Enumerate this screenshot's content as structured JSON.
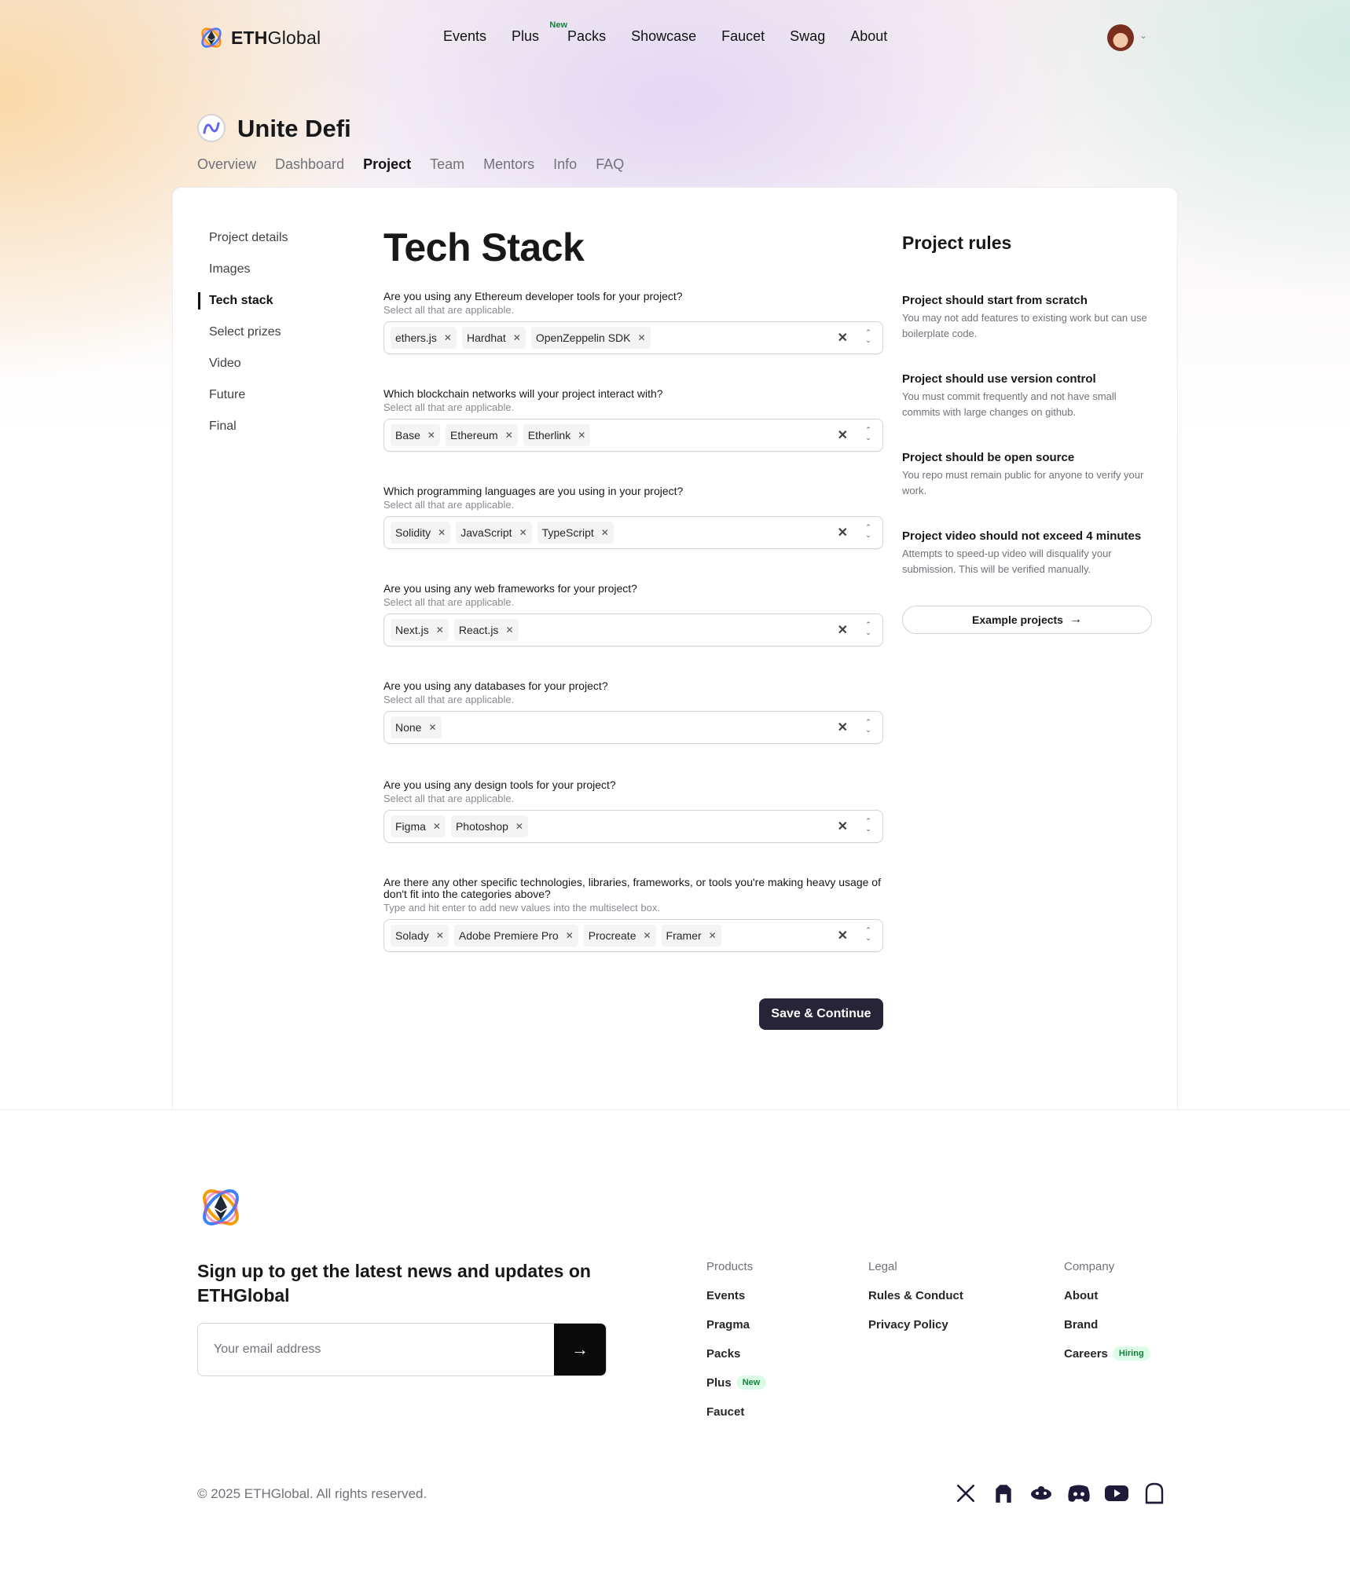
{
  "brand": {
    "name_bold": "ETH",
    "name_rest": "Global"
  },
  "nav": {
    "items": [
      "Events",
      "Plus",
      "Packs",
      "Showcase",
      "Faucet",
      "Swag",
      "About"
    ],
    "plus_badge": "New"
  },
  "event": {
    "title": "Unite Defi",
    "tabs": [
      "Overview",
      "Dashboard",
      "Project",
      "Team",
      "Mentors",
      "Info",
      "FAQ"
    ],
    "active_tab": "Project"
  },
  "sidebar": {
    "items": [
      "Project details",
      "Images",
      "Tech stack",
      "Select prizes",
      "Video",
      "Future",
      "Final"
    ],
    "active": "Tech stack"
  },
  "main": {
    "title": "Tech Stack",
    "questions": [
      {
        "label": "Are you using any Ethereum developer tools for your project?",
        "hint": "Select all that are applicable.",
        "tags": [
          "ethers.js",
          "Hardhat",
          "OpenZeppelin SDK"
        ]
      },
      {
        "label": "Which blockchain networks will your project interact with?",
        "hint": "Select all that are applicable.",
        "tags": [
          "Base",
          "Ethereum",
          "Etherlink"
        ]
      },
      {
        "label": "Which programming languages are you using in your project?",
        "hint": "Select all that are applicable.",
        "tags": [
          "Solidity",
          "JavaScript",
          "TypeScript"
        ]
      },
      {
        "label": "Are you using any web frameworks for your project?",
        "hint": "Select all that are applicable.",
        "tags": [
          "Next.js",
          "React.js"
        ]
      },
      {
        "label": "Are you using any databases for your project?",
        "hint": "Select all that are applicable.",
        "tags": [
          "None"
        ]
      },
      {
        "label": "Are you using any design tools for your project?",
        "hint": "Select all that are applicable.",
        "tags": [
          "Figma",
          "Photoshop"
        ]
      },
      {
        "label": "Are there any other specific technologies, libraries, frameworks, or tools you're making heavy usage of don't fit into the categories above?",
        "hint": "Type and hit enter to add new values into the multiselect box.",
        "tags": [
          "Solady",
          "Adobe Premiere Pro",
          "Procreate",
          "Framer"
        ]
      }
    ],
    "save_label": "Save & Continue"
  },
  "rules": {
    "title": "Project rules",
    "items": [
      {
        "title": "Project should start from scratch",
        "desc": "You may not add features to existing work but can use boilerplate code."
      },
      {
        "title": "Project should use version control",
        "desc": "You must commit frequently and not have small commits with large changes on github."
      },
      {
        "title": "Project should be open source",
        "desc": "You repo must remain public for anyone to verify your work."
      },
      {
        "title": "Project video should not exceed 4 minutes",
        "desc": "Attempts to speed-up video will disqualify your submission. This will be verified manually."
      }
    ],
    "example_label": "Example projects"
  },
  "footer": {
    "signup_title": "Sign up to get the latest news and updates on ETHGlobal",
    "email_placeholder": "Your email address",
    "columns": [
      {
        "heading": "Products",
        "links": [
          {
            "label": "Events"
          },
          {
            "label": "Pragma"
          },
          {
            "label": "Packs"
          },
          {
            "label": "Plus",
            "badge": "New"
          },
          {
            "label": "Faucet"
          }
        ]
      },
      {
        "heading": "Legal",
        "links": [
          {
            "label": "Rules & Conduct"
          },
          {
            "label": "Privacy Policy"
          }
        ]
      },
      {
        "heading": "Company",
        "links": [
          {
            "label": "About"
          },
          {
            "label": "Brand"
          },
          {
            "label": "Careers",
            "badge": "Hiring"
          }
        ]
      }
    ],
    "copyright": "© 2025 ETHGlobal. All rights reserved.",
    "socials": [
      "x-icon",
      "github-icon",
      "farcaster-icon",
      "discord-icon",
      "youtube-icon",
      "ghost-icon"
    ]
  },
  "colors": {
    "accent_dark": "#262436",
    "badge_green": "#15803d",
    "badge_bg": "#dcfce7"
  }
}
